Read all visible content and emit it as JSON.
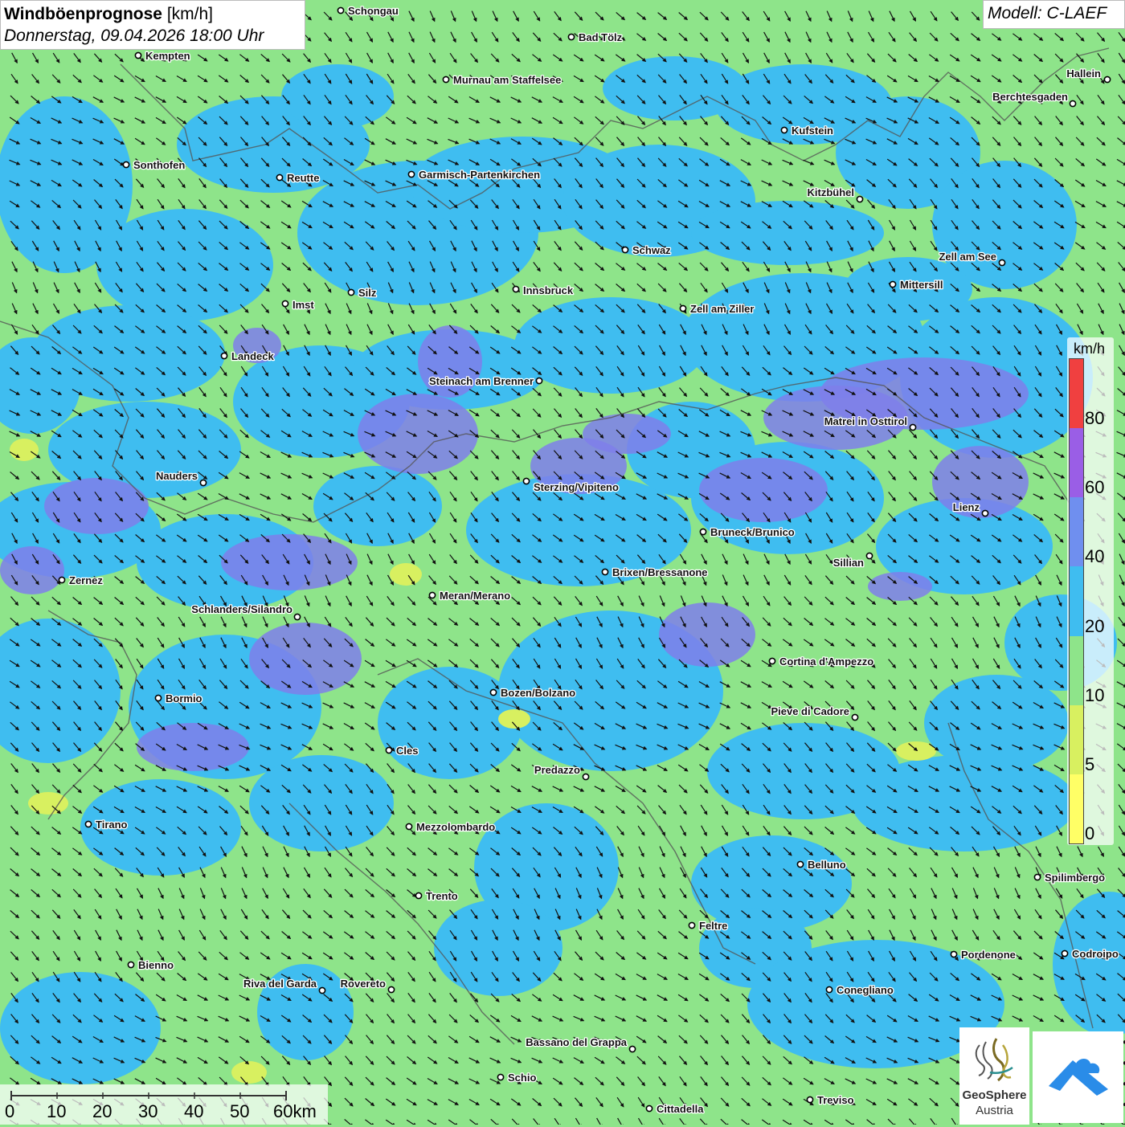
{
  "header": {
    "title": "Windböenprognose",
    "unit": "[km/h]",
    "datetime": "Donnerstag, 09.04.2026 18:00 Uhr",
    "model": "Modell: C-LAEF"
  },
  "legend": {
    "unit": "km/h",
    "ticks": [
      "0",
      "5",
      "10",
      "20",
      "40",
      "60",
      "80"
    ],
    "colors": [
      "#ffff66",
      "#d8f060",
      "#8ee48a",
      "#3fbdf0",
      "#6f8fef",
      "#9a5ee6",
      "#f04040"
    ]
  },
  "scalebar": {
    "labels": [
      "0",
      "10",
      "20",
      "30",
      "40",
      "50",
      "60km"
    ]
  },
  "map": {
    "colors": {
      "calm": "#8ee48a",
      "moderate": "#3fbdf0",
      "strong": "#7f7fea",
      "weak": "#d8f060",
      "border": "#555555"
    },
    "cities": [
      "Schongau",
      "Bad Tölz",
      "Kempten",
      "Murnau am Staffelsee",
      "Hallein",
      "Berchtesgaden",
      "Kufstein",
      "Sonthofen",
      "Reutte",
      "Garmisch-Partenkirchen",
      "Kitzbühel",
      "Schwaz",
      "Zell am See",
      "Mittersill",
      "Innsbruck",
      "Silz",
      "Imst",
      "Zell am Ziller",
      "Landeck",
      "Steinach am Brenner",
      "Matrei in Osttirol",
      "Nauders",
      "Sterzing/Vipiteno",
      "Lienz",
      "Bruneck/Brunico",
      "Sillian",
      "Brixen/Bressanone",
      "Zernez",
      "Meran/Merano",
      "Schlanders/Silandro",
      "Cortina d'Ampezzo",
      "Bozen/Bolzano",
      "Bormio",
      "Pieve di Cadore",
      "Cles",
      "Predazzo",
      "Tirano",
      "Mezzolombardo",
      "Belluno",
      "Spilimbergo",
      "Trento",
      "Feltre",
      "Pordenone",
      "Codroipo",
      "Bienno",
      "Riva del Garda",
      "Rovereto",
      "Conegliano",
      "Bassano del Grappa",
      "Schio",
      "Treviso",
      "Cittadella"
    ]
  },
  "logos": {
    "geosphere_name": "GeoSphere",
    "geosphere_sub": "Austria",
    "app_icon": "mountain-cloud-icon"
  }
}
